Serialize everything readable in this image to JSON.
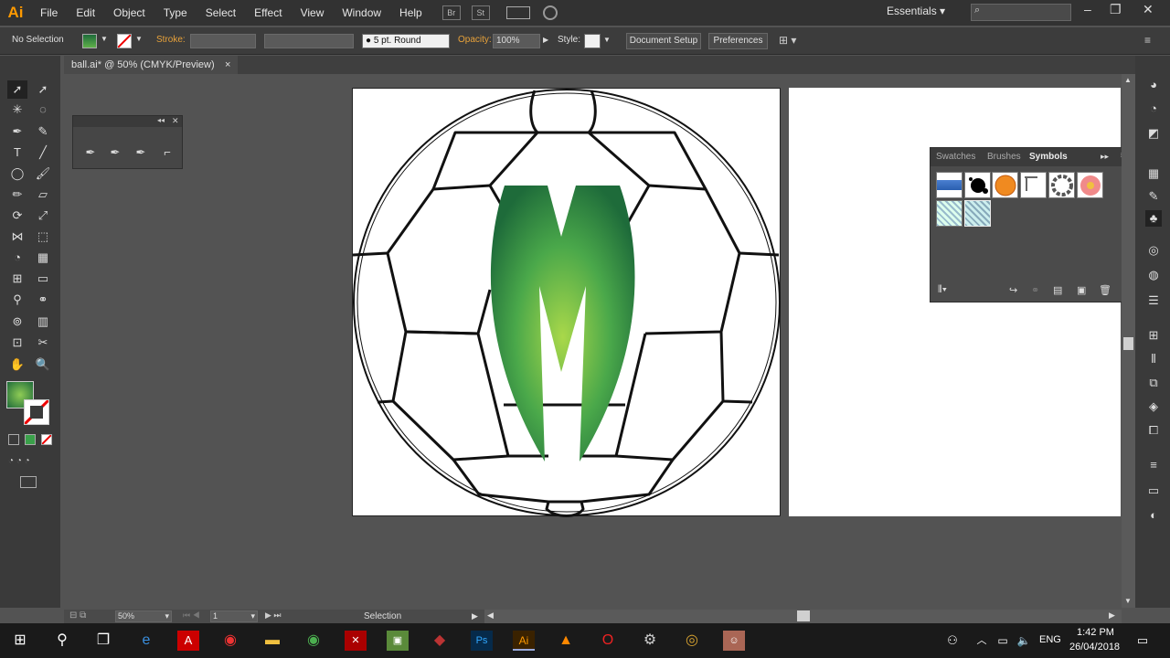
{
  "app": {
    "logo": "Ai",
    "workspace": "Essentials",
    "search_placeholder": ""
  },
  "menu": [
    "File",
    "Edit",
    "Object",
    "Type",
    "Select",
    "Effect",
    "View",
    "Window",
    "Help"
  ],
  "menubar_buttons": [
    "Br",
    "St"
  ],
  "control": {
    "selection": "No Selection",
    "stroke_label": "Stroke:",
    "brush": "5 pt. Round",
    "opacity_label": "Opacity:",
    "opacity_value": "100%",
    "style_label": "Style:",
    "doc_setup": "Document Setup",
    "preferences": "Preferences"
  },
  "document_tab": {
    "title": "ball.ai* @ 50% (CMYK/Preview)",
    "close": "×"
  },
  "status": {
    "zoom": "50%",
    "page": "1",
    "tool": "Selection"
  },
  "panel": {
    "tabs": [
      "Swatches",
      "Brushes",
      "Symbols"
    ],
    "active_tab": "Symbols"
  },
  "taskbar": {
    "time": "1:42 PM",
    "date": "26/04/2018",
    "lang": "ENG"
  },
  "colors": {
    "fill_gradient_dark": "#1e6b3a",
    "fill_gradient_light": "#9fd24a",
    "accent": "#ff9a00"
  }
}
